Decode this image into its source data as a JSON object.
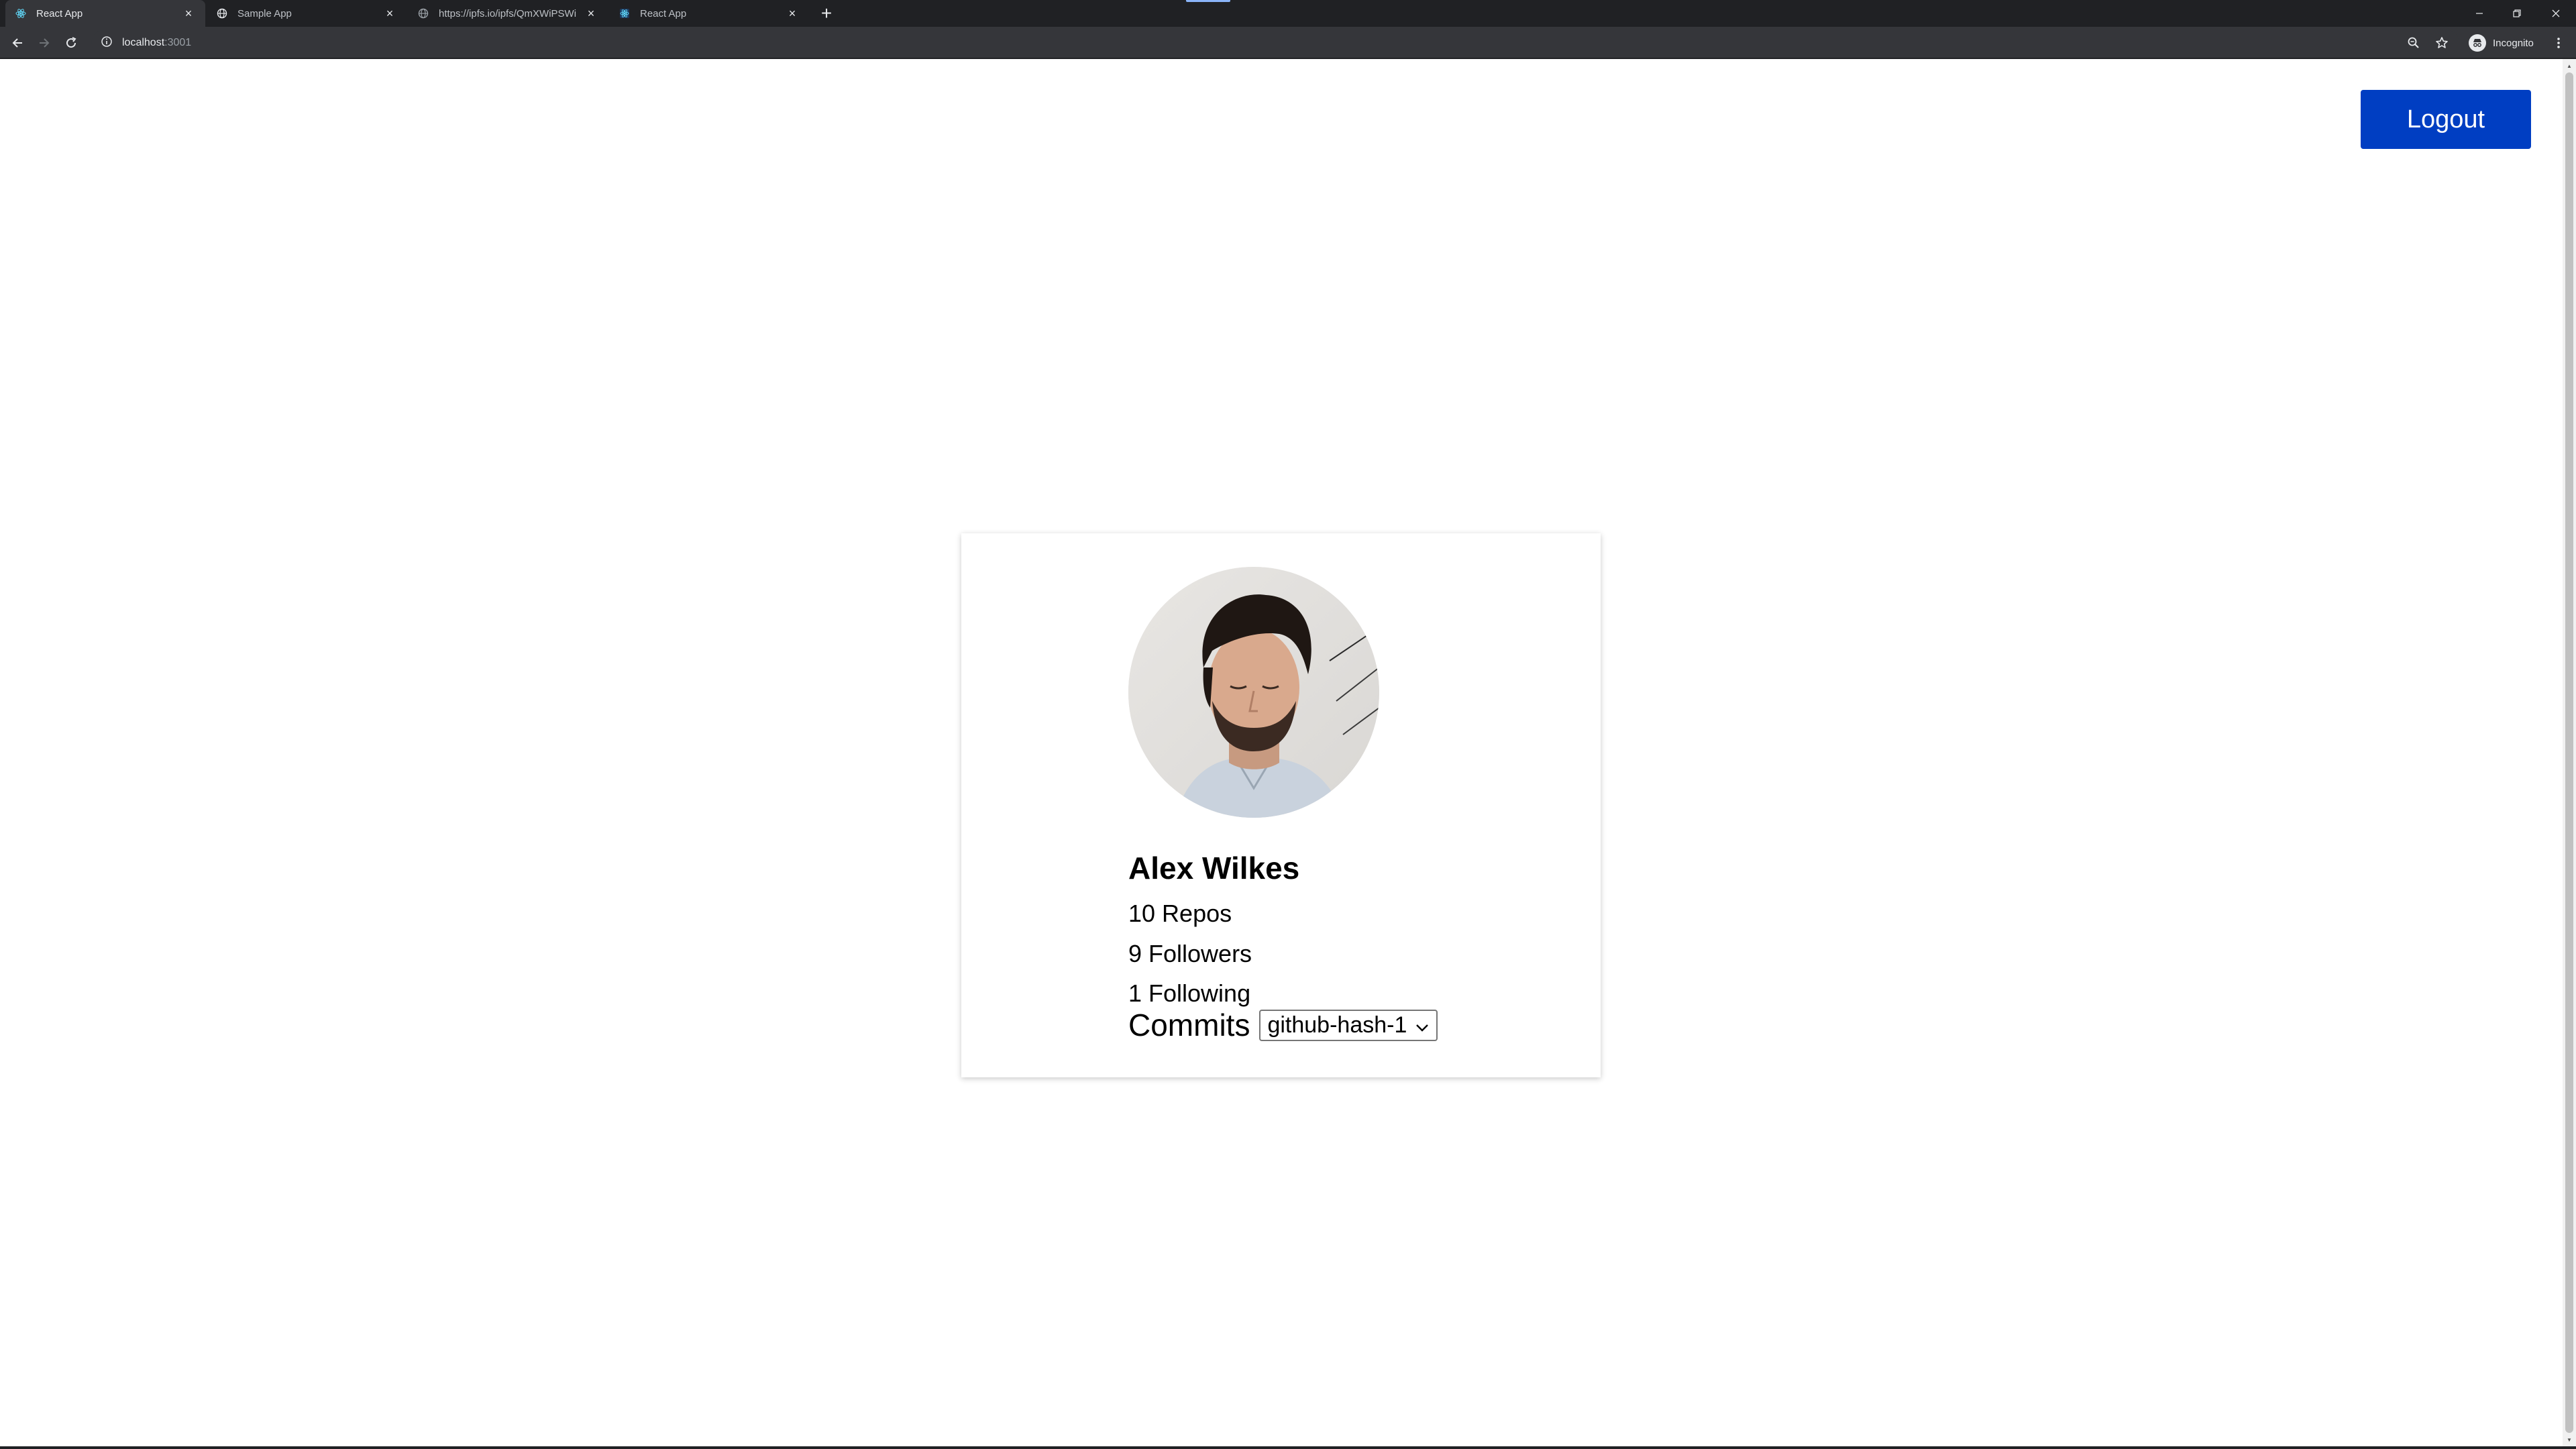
{
  "browser": {
    "tabs": [
      {
        "title": "React App",
        "icon": "react-icon",
        "active": true
      },
      {
        "title": "Sample App",
        "icon": "globe-icon",
        "active": false
      },
      {
        "title": "https://ipfs.io/ipfs/QmXWiPSWi",
        "icon": "globe-icon",
        "active": false
      },
      {
        "title": "React App",
        "icon": "react-icon",
        "active": false
      }
    ],
    "address": {
      "host": "localhost",
      "port": ":3001"
    },
    "incognito_label": "Incognito"
  },
  "page": {
    "logout_label": "Logout",
    "profile": {
      "name": "Alex Wilkes",
      "repos": "10 Repos",
      "followers": "9 Followers",
      "following": "1 Following",
      "commits_label": "Commits",
      "commits_selected": "github-hash-1"
    }
  },
  "colors": {
    "logout_bg": "#003ec2",
    "chrome_dark": "#202124",
    "chrome_toolbar": "#35363a"
  }
}
